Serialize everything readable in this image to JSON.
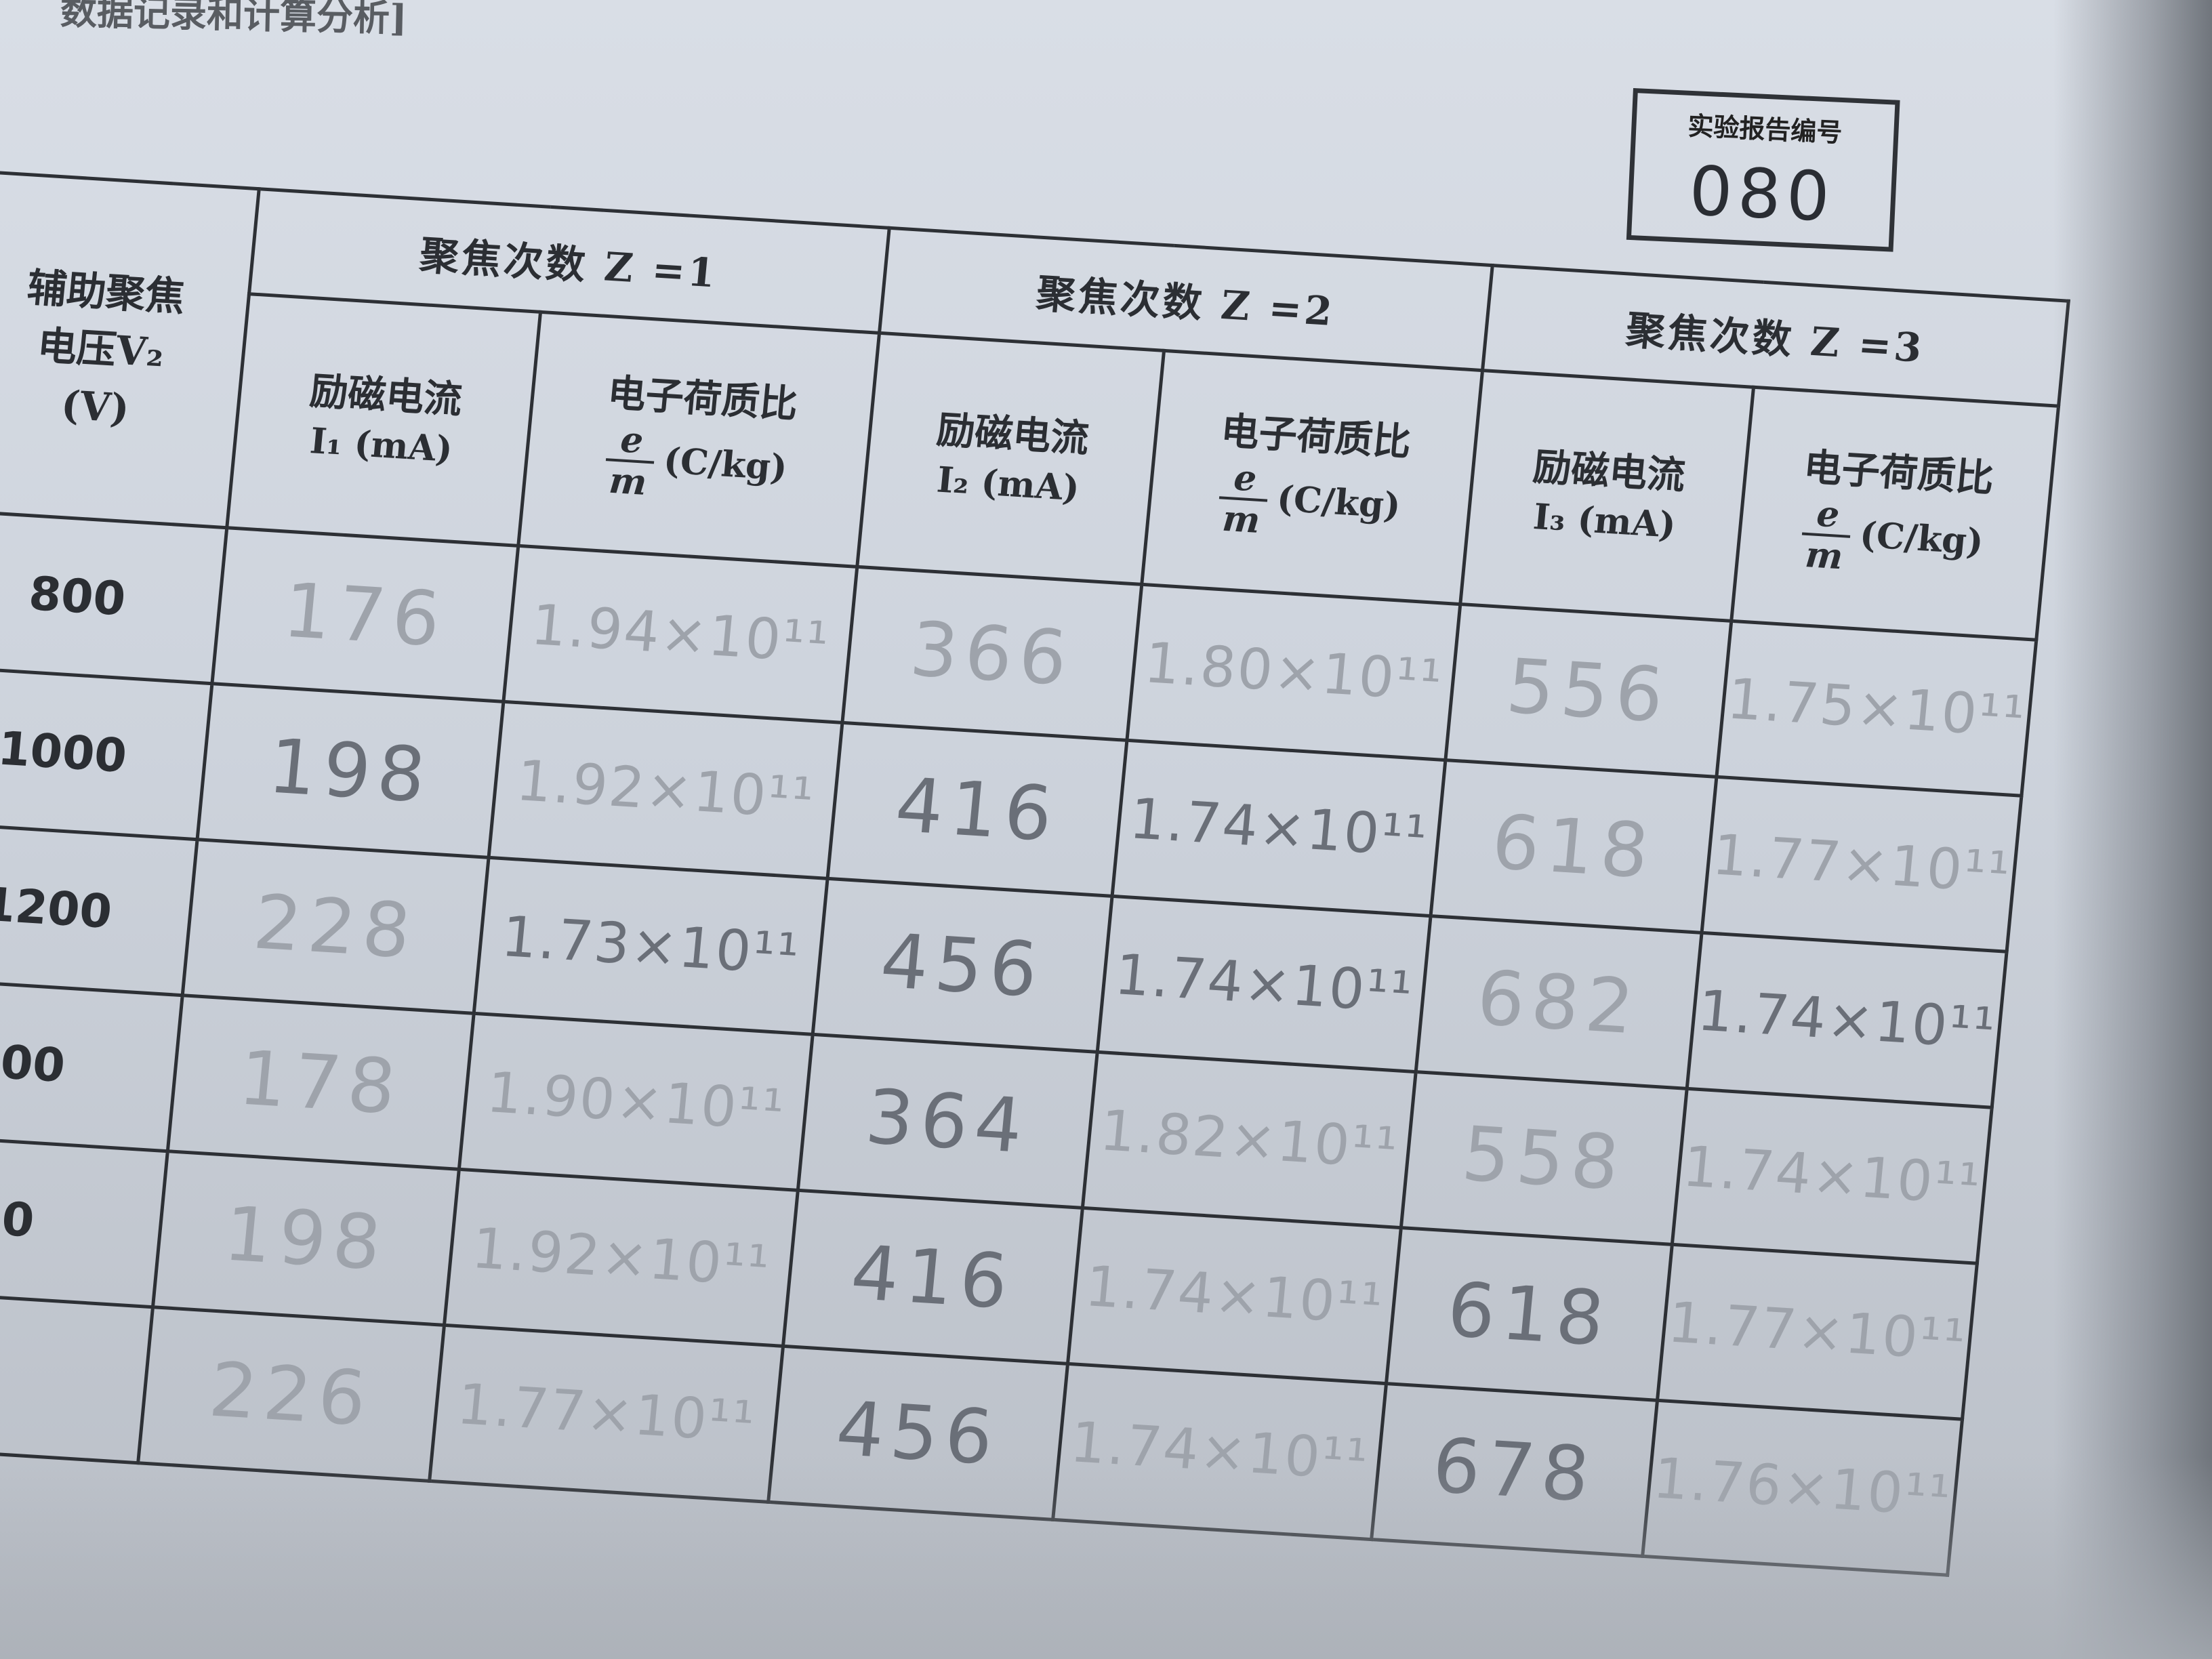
{
  "page": {
    "section_heading": "数据记录和计算分析]"
  },
  "report_box": {
    "label": "实验报告编号",
    "number": "080"
  },
  "table": {
    "row_header": {
      "line1": "辅助聚焦",
      "line2": "电压V₂",
      "unit": "(V)"
    },
    "groups": [
      {
        "label": "聚焦次数 Z =1",
        "current_label": "励磁电流",
        "current_symbol": "I₁ (mA)",
        "ratio_label": "电子荷质比",
        "ratio_num": "e",
        "ratio_den": "m",
        "ratio_unit": "(C/kg)"
      },
      {
        "label": "聚焦次数 Z =2",
        "current_label": "励磁电流",
        "current_symbol": "I₂ (mA)",
        "ratio_label": "电子荷质比",
        "ratio_num": "e",
        "ratio_den": "m",
        "ratio_unit": "(C/kg)"
      },
      {
        "label": "聚焦次数 Z =3",
        "current_label": "励磁电流",
        "current_symbol": "I₃ (mA)",
        "ratio_label": "电子荷质比",
        "ratio_num": "e",
        "ratio_den": "m",
        "ratio_unit": "(C/kg)"
      }
    ],
    "rows": [
      {
        "v2": "800",
        "i1": "176",
        "r1": "1.94×10¹¹",
        "i2": "366",
        "r2": "1.80×10¹¹",
        "i3": "556",
        "r3": "1.75×10¹¹"
      },
      {
        "v2": "1000",
        "i1": "198",
        "r1": "1.92×10¹¹",
        "i2": "416",
        "r2": "1.74×10¹¹",
        "i3": "618",
        "r3": "1.77×10¹¹"
      },
      {
        "v2": "1200",
        "i1": "228",
        "r1": "1.73×10¹¹",
        "i2": "456",
        "r2": "1.74×10¹¹",
        "i3": "682",
        "r3": "1.74×10¹¹"
      },
      {
        "v2": "00",
        "i1": "178",
        "r1": "1.90×10¹¹",
        "i2": "364",
        "r2": "1.82×10¹¹",
        "i3": "558",
        "r3": "1.74×10¹¹"
      },
      {
        "v2": "0",
        "i1": "198",
        "r1": "1.92×10¹¹",
        "i2": "416",
        "r2": "1.74×10¹¹",
        "i3": "618",
        "r3": "1.77×10¹¹"
      },
      {
        "v2": "",
        "i1": "226",
        "r1": "1.77×10¹¹",
        "i2": "456",
        "r2": "1.74×10¹¹",
        "i3": "678",
        "r3": "1.76×10¹¹"
      }
    ]
  }
}
